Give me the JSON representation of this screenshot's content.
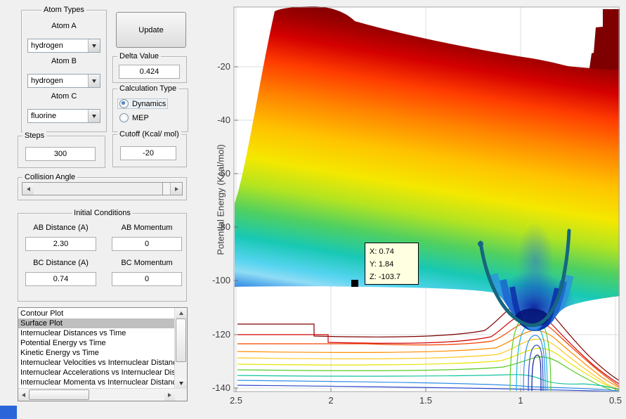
{
  "controls": {
    "atom_types": {
      "title": "Atom Types",
      "fields": [
        {
          "label": "Atom A",
          "value": "hydrogen"
        },
        {
          "label": "Atom B",
          "value": "hydrogen"
        },
        {
          "label": "Atom C",
          "value": "fluorine"
        }
      ]
    },
    "update_button": {
      "label": "Update"
    },
    "delta_value": {
      "title": "Delta Value",
      "value": "0.424"
    },
    "calculation_type": {
      "title": "Calculation Type",
      "options": [
        {
          "label": "Dynamics",
          "selected": true
        },
        {
          "label": "MEP",
          "selected": false
        }
      ]
    },
    "steps": {
      "title": "Steps",
      "value": "300"
    },
    "cutoff": {
      "title": "Cutoff (Kcal/ mol)",
      "value": "-20"
    },
    "collision_angle": {
      "title": "Collision Angle"
    },
    "initial_conditions": {
      "title": "Initial Conditions",
      "fields": [
        {
          "label": "AB Distance (A)",
          "value": "2.30"
        },
        {
          "label": "AB Momentum",
          "value": "0"
        },
        {
          "label": "BC Distance (A)",
          "value": "0.74"
        },
        {
          "label": "BC Momentum",
          "value": "0"
        }
      ]
    },
    "plot_list": {
      "items": [
        "Contour Plot",
        "Surface Plot",
        "Internuclear Distances vs Time",
        "Potential Energy vs Time",
        "Kinetic Energy vs Time",
        "Internuclear Velocities vs Internuclear Distance",
        "Internuclear Accelerations vs Internuclear Distance",
        "Internuclear Momenta vs Internuclear Distance"
      ],
      "selected": "Surface Plot",
      "selected_index": 1
    }
  },
  "chart_data": {
    "type": "3d-surface-with-contour",
    "ylabel": "Potential Energy (Kcal/mol)",
    "y_ticks": [
      "-20",
      "-40",
      "-60",
      "-80",
      "-100",
      "-120",
      "-140"
    ],
    "x_ticks": [
      "2.5",
      "2",
      "1.5",
      "1",
      "0.5"
    ],
    "energy_axis_range": [
      -140,
      -20
    ],
    "distance_axis_range": [
      2.5,
      0.5
    ],
    "x_axis_reversed": true,
    "grid": true,
    "colormap_name": "jet",
    "cutoff_plateau_color": "#7f0000",
    "trajectory_color": "#15677e",
    "known_points": [
      {
        "x": 0.74,
        "y": 1.84,
        "z": -103.7
      }
    ],
    "datatip": {
      "lines": [
        "X: 0.74",
        "Y: 1.84",
        "Z: -103.7"
      ],
      "marker_color": "#000000",
      "background": "#ffffe1"
    },
    "colormap": [
      {
        "offset": 0.0,
        "color": "#7f0000"
      },
      {
        "offset": 0.05,
        "color": "#9b0000"
      },
      {
        "offset": 0.12,
        "color": "#d40000"
      },
      {
        "offset": 0.2,
        "color": "#ff3c00"
      },
      {
        "offset": 0.3,
        "color": "#ff8400"
      },
      {
        "offset": 0.4,
        "color": "#ffc200"
      },
      {
        "offset": 0.5,
        "color": "#f4e800"
      },
      {
        "offset": 0.58,
        "color": "#b4e420"
      },
      {
        "offset": 0.66,
        "color": "#50d060"
      },
      {
        "offset": 0.74,
        "color": "#18c8b4"
      },
      {
        "offset": 0.81,
        "color": "#55d4f0"
      },
      {
        "offset": 0.845,
        "color": "#90dcf5"
      },
      {
        "offset": 0.88,
        "color": "#49a0e8"
      },
      {
        "offset": 0.93,
        "color": "#1d52cc"
      },
      {
        "offset": 1.0,
        "color": "#0a1f9e"
      }
    ],
    "contour_colors": [
      "#7f0000",
      "#cf0000",
      "#f34300",
      "#ff8c00",
      "#ffc81e",
      "#e8e400",
      "#58cc28",
      "#10c49c",
      "#2f8fe8",
      "#2a48d0"
    ],
    "well_contour_colors": [
      "#58cc28",
      "#18b8d8",
      "#2f8fe8",
      "#2a48d0",
      "#101d90"
    ]
  }
}
